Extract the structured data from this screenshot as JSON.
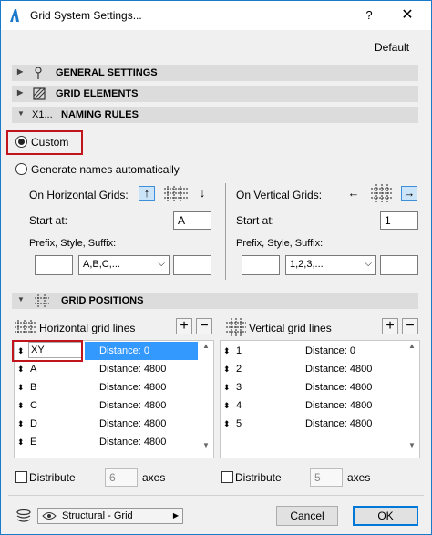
{
  "window": {
    "title": "Grid System Settings...",
    "help_label": "?",
    "close_label": "✕",
    "default_label": "Default"
  },
  "sections": {
    "general": "GENERAL SETTINGS",
    "elements": "GRID ELEMENTS",
    "naming": "NAMING RULES",
    "naming_icon_text": "X1...",
    "positions": "GRID POSITIONS"
  },
  "naming": {
    "custom_label": "Custom",
    "auto_label": "Generate names automatically",
    "horizontal": {
      "title": "On Horizontal Grids:",
      "start_label": "Start at:",
      "start_value": "A",
      "psx_label": "Prefix, Style, Suffix:",
      "prefix": "",
      "style": "A,B,C,...",
      "suffix": "",
      "arrow_up": "↑",
      "arrow_down": "↓"
    },
    "vertical": {
      "title": "On Vertical Grids:",
      "start_label": "Start at:",
      "start_value": "1",
      "psx_label": "Prefix, Style, Suffix:",
      "prefix": "",
      "style": "1,2,3,...",
      "suffix": "",
      "arrow_left": "←",
      "arrow_right": "→"
    }
  },
  "positions": {
    "horizontal": {
      "title": "Horizontal grid lines",
      "rows": [
        {
          "name": "XY",
          "distance": "Distance: 0"
        },
        {
          "name": "A",
          "distance": "Distance: 4800"
        },
        {
          "name": "B",
          "distance": "Distance: 4800"
        },
        {
          "name": "C",
          "distance": "Distance: 4800"
        },
        {
          "name": "D",
          "distance": "Distance: 4800"
        },
        {
          "name": "E",
          "distance": "Distance: 4800"
        }
      ],
      "distribute_label": "Distribute",
      "axes_value": "6",
      "axes_label": "axes"
    },
    "vertical": {
      "title": "Vertical grid lines",
      "rows": [
        {
          "name": "1",
          "distance": "Distance: 0"
        },
        {
          "name": "2",
          "distance": "Distance: 4800"
        },
        {
          "name": "3",
          "distance": "Distance: 4800"
        },
        {
          "name": "4",
          "distance": "Distance: 4800"
        },
        {
          "name": "5",
          "distance": "Distance: 4800"
        }
      ],
      "distribute_label": "Distribute",
      "axes_value": "5",
      "axes_label": "axes"
    },
    "add_label": "+",
    "remove_label": "−"
  },
  "footer": {
    "layer": "Structural - Grid",
    "cancel": "Cancel",
    "ok": "OK"
  },
  "colors": {
    "accent": "#1979ca",
    "highlight": "#c0151d",
    "selection": "#3399ff"
  }
}
